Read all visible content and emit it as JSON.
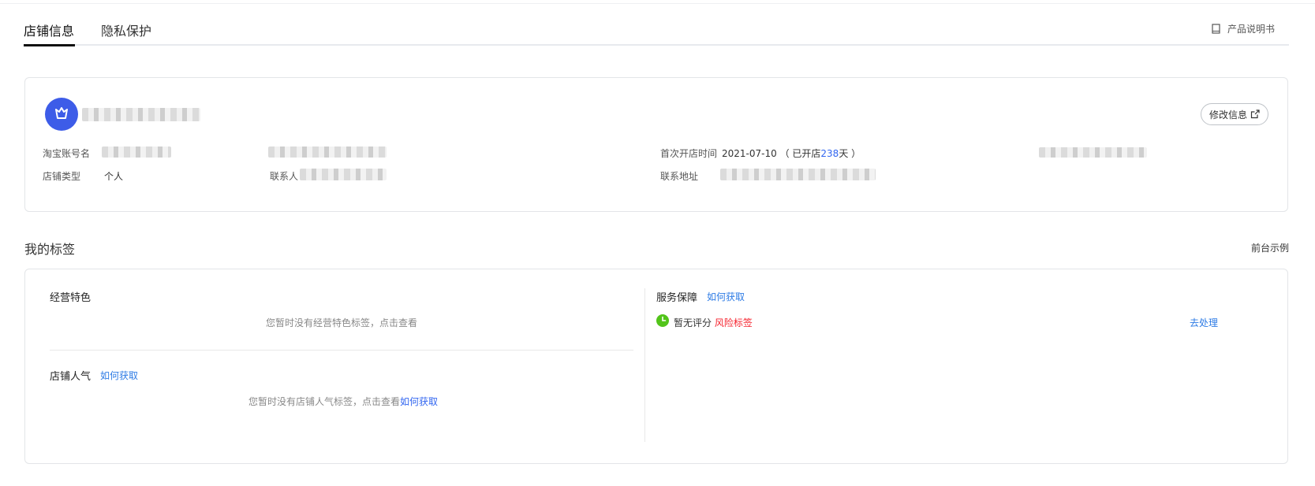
{
  "tabs": [
    {
      "label": "店铺信息",
      "active": true
    },
    {
      "label": "隐私保护",
      "active": false
    }
  ],
  "manual_link": "产品说明书",
  "store_card": {
    "edit_button": "修改信息",
    "fields": {
      "taobao_account_label": "淘宝账号名",
      "store_type_label": "店铺类型",
      "store_type_value": "个人",
      "contact_label": "联系人",
      "first_open_label": "首次开店时间",
      "first_open_date": "2021-07-10",
      "opened_prefix": "（ 已开店",
      "opened_days": "238",
      "opened_suffix": "天 ）",
      "address_label": "联系地址"
    }
  },
  "tags_section": {
    "title": "我的标签",
    "front_example": "前台示例",
    "business_features": {
      "title": "经营特色",
      "empty_text": "您暂时没有经营特色标签，点击查看"
    },
    "store_popularity": {
      "title": "店铺人气",
      "how_to_get": "如何获取",
      "empty_text": "您暂时没有店铺人气标签，点击查看",
      "empty_link": "如何获取"
    },
    "service_guarantee": {
      "title": "服务保障",
      "how_to_get": "如何获取",
      "status_text": "暂无评分",
      "risk_label": "风险标签",
      "action": "去处理"
    }
  },
  "colors": {
    "accent": "#2d7be5",
    "risk": "#f5222d",
    "success": "#52c41a",
    "avatar_bg": "#3d5ce8"
  }
}
